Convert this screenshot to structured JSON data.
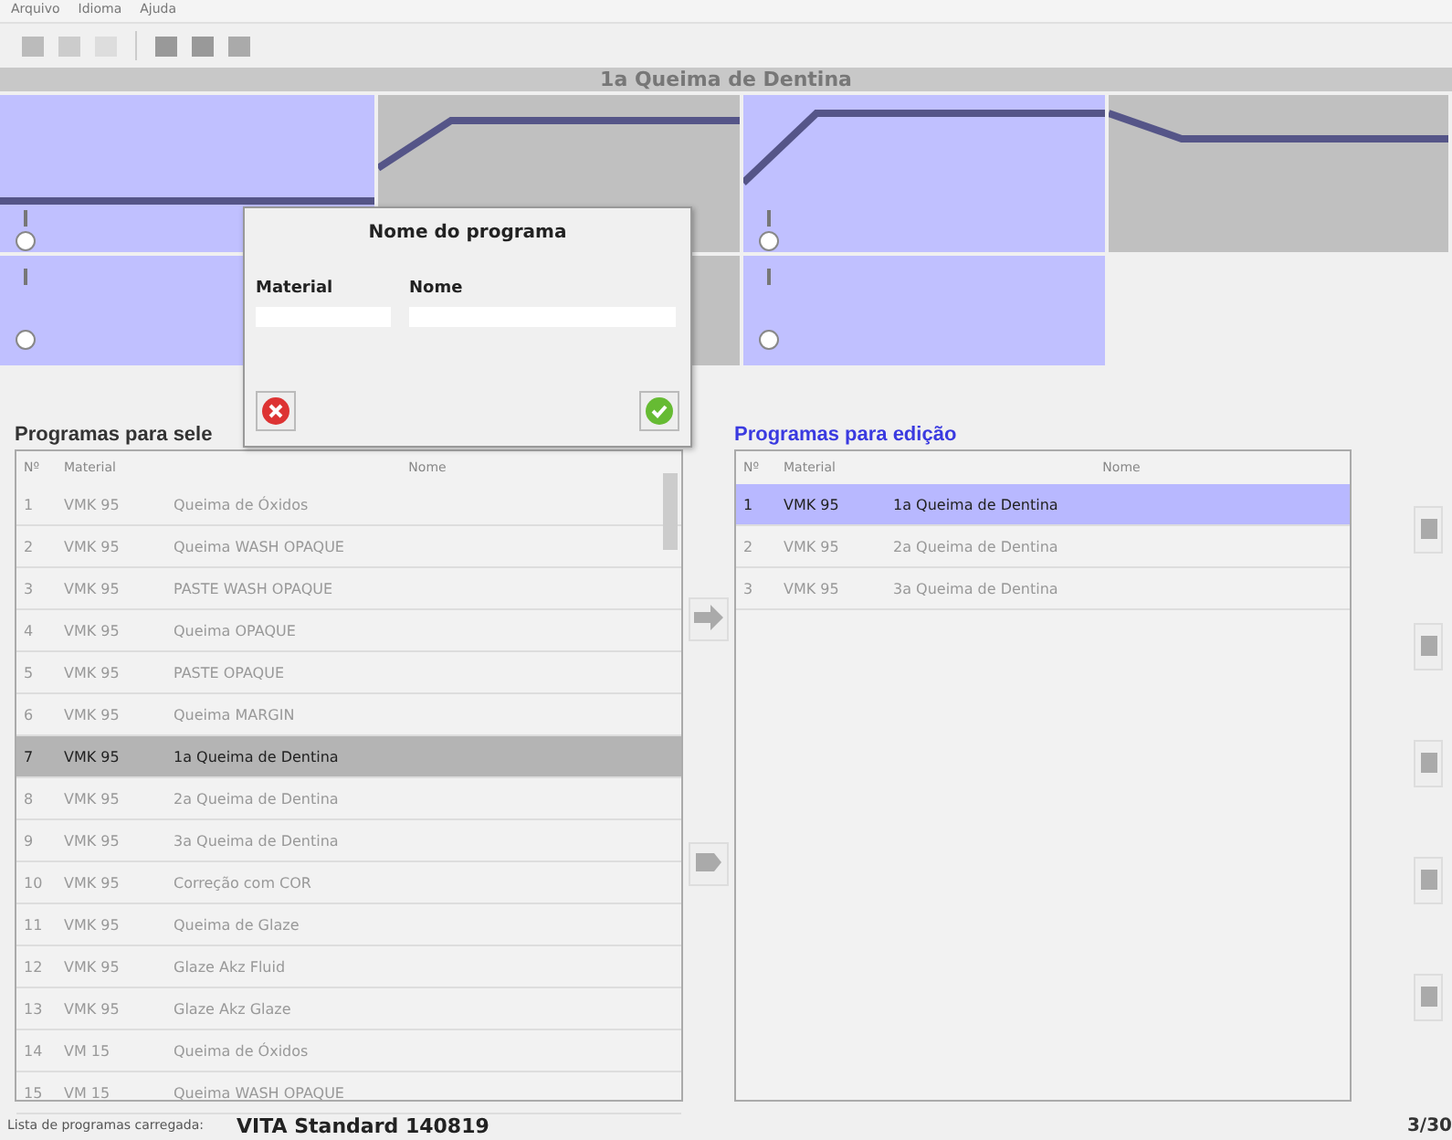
{
  "menu": [
    "Arquivo",
    "Idioma",
    "Ajuda"
  ],
  "program_title": "1a Queima de Dentina",
  "stages": [
    {
      "kind": "active",
      "top": true
    },
    {
      "kind": "inactive",
      "top": true
    },
    {
      "kind": "active",
      "top": true
    },
    {
      "kind": "inactive",
      "top": true
    },
    {
      "kind": "active",
      "top": false
    },
    {
      "kind": "inactive",
      "top": false
    },
    {
      "kind": "active",
      "top": false
    }
  ],
  "dialog": {
    "title": "Nome do programa",
    "material_label": "Material",
    "name_label": "Nome"
  },
  "select_panel": {
    "title": "Programas para sele",
    "columns": [
      "Nº",
      "Material",
      "Nome"
    ],
    "rows": [
      {
        "no": "1",
        "material": "VMK 95",
        "name": "Queima de Óxidos",
        "selected": false
      },
      {
        "no": "2",
        "material": "VMK 95",
        "name": "Queima WASH OPAQUE",
        "selected": false
      },
      {
        "no": "3",
        "material": "VMK 95",
        "name": "PASTE WASH OPAQUE",
        "selected": false
      },
      {
        "no": "4",
        "material": "VMK 95",
        "name": "Queima OPAQUE",
        "selected": false
      },
      {
        "no": "5",
        "material": "VMK 95",
        "name": "PASTE OPAQUE",
        "selected": false
      },
      {
        "no": "6",
        "material": "VMK 95",
        "name": "Queima MARGIN",
        "selected": false
      },
      {
        "no": "7",
        "material": "VMK 95",
        "name": "1a Queima de Dentina",
        "selected": true
      },
      {
        "no": "8",
        "material": "VMK 95",
        "name": "2a Queima de Dentina",
        "selected": false
      },
      {
        "no": "9",
        "material": "VMK 95",
        "name": "3a Queima de Dentina",
        "selected": false
      },
      {
        "no": "10",
        "material": "VMK 95",
        "name": "Correção com COR",
        "selected": false
      },
      {
        "no": "11",
        "material": "VMK 95",
        "name": "Queima de Glaze",
        "selected": false
      },
      {
        "no": "12",
        "material": "VMK 95",
        "name": "Glaze Akz Fluid",
        "selected": false
      },
      {
        "no": "13",
        "material": "VMK 95",
        "name": "Glaze Akz Glaze",
        "selected": false
      },
      {
        "no": "14",
        "material": "VM 15",
        "name": "Queima de Óxidos",
        "selected": false
      },
      {
        "no": "15",
        "material": "VM 15",
        "name": "Queima WASH OPAQUE",
        "selected": false
      }
    ]
  },
  "edit_panel": {
    "title": "Programas para edição",
    "columns": [
      "Nº",
      "Material",
      "Nome"
    ],
    "rows": [
      {
        "no": "1",
        "material": "VMK 95",
        "name": "1a Queima de Dentina",
        "selected": true
      },
      {
        "no": "2",
        "material": "VMK 95",
        "name": "2a Queima de Dentina",
        "selected": false
      },
      {
        "no": "3",
        "material": "VMK 95",
        "name": "3a Queima de Dentina",
        "selected": false
      }
    ]
  },
  "status_bar": {
    "label": "Lista de programas carregada:",
    "list_name": "VITA Standard 140819",
    "count": "3/30"
  }
}
